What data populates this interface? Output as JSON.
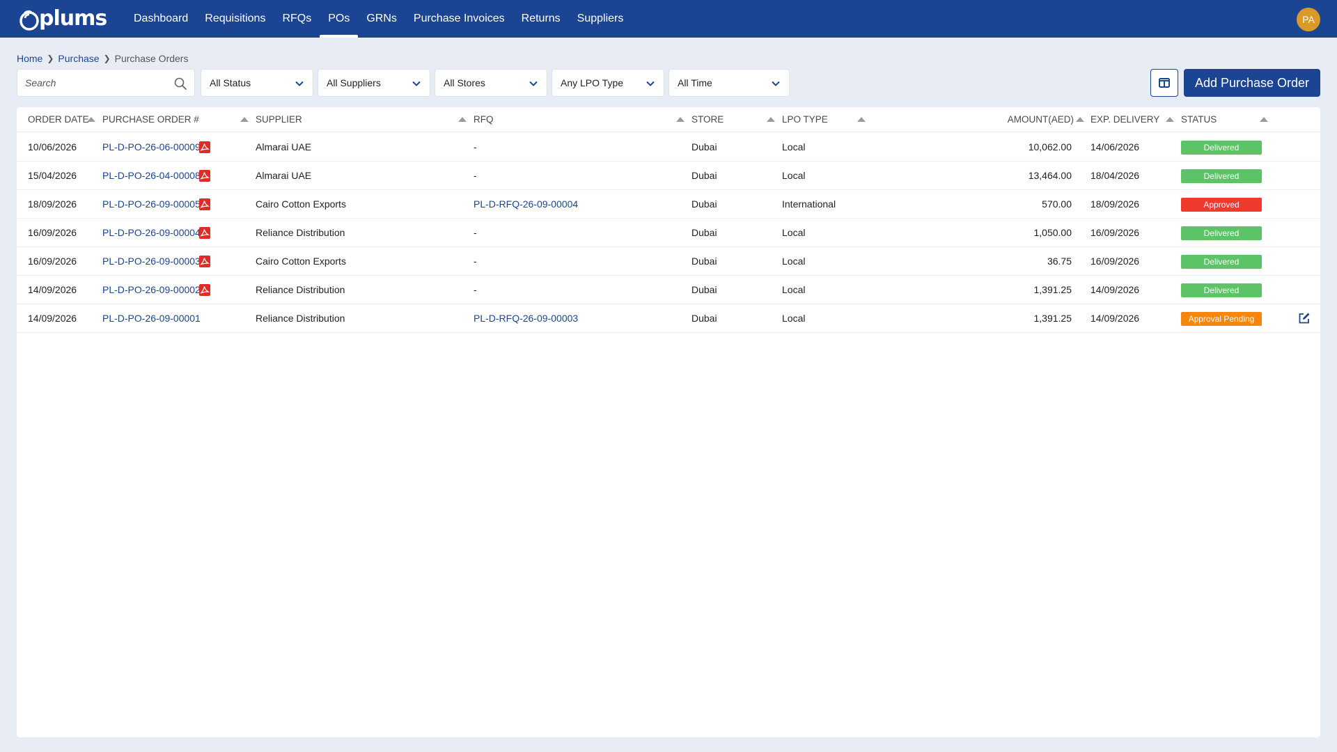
{
  "app": {
    "logo_text": "plums"
  },
  "nav": {
    "items": [
      "Dashboard",
      "Requisitions",
      "RFQs",
      "POs",
      "GRNs",
      "Purchase Invoices",
      "Returns",
      "Suppliers"
    ],
    "active": "POs"
  },
  "user": {
    "initials": "PA",
    "avatar_color": "#d99a27"
  },
  "breadcrumb": {
    "home": "Home",
    "purchase": "Purchase",
    "current": "Purchase Orders"
  },
  "filters": {
    "search_placeholder": "Search",
    "status": "All Status",
    "suppliers": "All Suppliers",
    "stores": "All Stores",
    "lpo_type": "Any LPO Type",
    "time": "All Time"
  },
  "actions": {
    "add_label": "Add Purchase Order"
  },
  "table": {
    "headers": {
      "order_date": "ORDER DATE",
      "po_number": "PURCHASE ORDER #",
      "supplier": "SUPPLIER",
      "rfq": "RFQ",
      "store": "STORE",
      "lpo_type": "LPO TYPE",
      "amount": "AMOUNT(AED)",
      "exp_delivery": "EXP. DELIVERY",
      "status": "STATUS"
    },
    "rows": [
      {
        "order_date": "10/06/2026",
        "po_number": "PL-D-PO-26-06-00009",
        "has_pdf": true,
        "supplier": "Almarai UAE",
        "rfq": "-",
        "store": "Dubai",
        "lpo_type": "Local",
        "amount": "10,062.00",
        "exp_delivery": "14/06/2026",
        "status": "Delivered",
        "editable": false
      },
      {
        "order_date": "15/04/2026",
        "po_number": "PL-D-PO-26-04-00008",
        "has_pdf": true,
        "supplier": "Almarai UAE",
        "rfq": "-",
        "store": "Dubai",
        "lpo_type": "Local",
        "amount": "13,464.00",
        "exp_delivery": "18/04/2026",
        "status": "Delivered",
        "editable": false
      },
      {
        "order_date": "18/09/2026",
        "po_number": "PL-D-PO-26-09-00005",
        "has_pdf": true,
        "supplier": "Cairo Cotton Exports",
        "rfq": "PL-D-RFQ-26-09-00004",
        "store": "Dubai",
        "lpo_type": "International",
        "amount": "570.00",
        "exp_delivery": "18/09/2026",
        "status": "Approved",
        "editable": false
      },
      {
        "order_date": "16/09/2026",
        "po_number": "PL-D-PO-26-09-00004",
        "has_pdf": true,
        "supplier": "Reliance Distribution",
        "rfq": "-",
        "store": "Dubai",
        "lpo_type": "Local",
        "amount": "1,050.00",
        "exp_delivery": "16/09/2026",
        "status": "Delivered",
        "editable": false
      },
      {
        "order_date": "16/09/2026",
        "po_number": "PL-D-PO-26-09-00003",
        "has_pdf": true,
        "supplier": "Cairo Cotton Exports",
        "rfq": "-",
        "store": "Dubai",
        "lpo_type": "Local",
        "amount": "36.75",
        "exp_delivery": "16/09/2026",
        "status": "Delivered",
        "editable": false
      },
      {
        "order_date": "14/09/2026",
        "po_number": "PL-D-PO-26-09-00002",
        "has_pdf": true,
        "supplier": "Reliance Distribution",
        "rfq": "-",
        "store": "Dubai",
        "lpo_type": "Local",
        "amount": "1,391.25",
        "exp_delivery": "14/09/2026",
        "status": "Delivered",
        "editable": false
      },
      {
        "order_date": "14/09/2026",
        "po_number": "PL-D-PO-26-09-00001",
        "has_pdf": false,
        "supplier": "Reliance Distribution",
        "rfq": "PL-D-RFQ-26-09-00003",
        "store": "Dubai",
        "lpo_type": "Local",
        "amount": "1,391.25",
        "exp_delivery": "14/09/2026",
        "status": "Approval Pending",
        "editable": true
      }
    ]
  },
  "status_colors": {
    "Delivered": "#5cc466",
    "Approved": "#f03a2e",
    "Approval Pending": "#f7860c"
  },
  "colors": {
    "brand": "#1b4592",
    "pdf": "#e02b26"
  }
}
